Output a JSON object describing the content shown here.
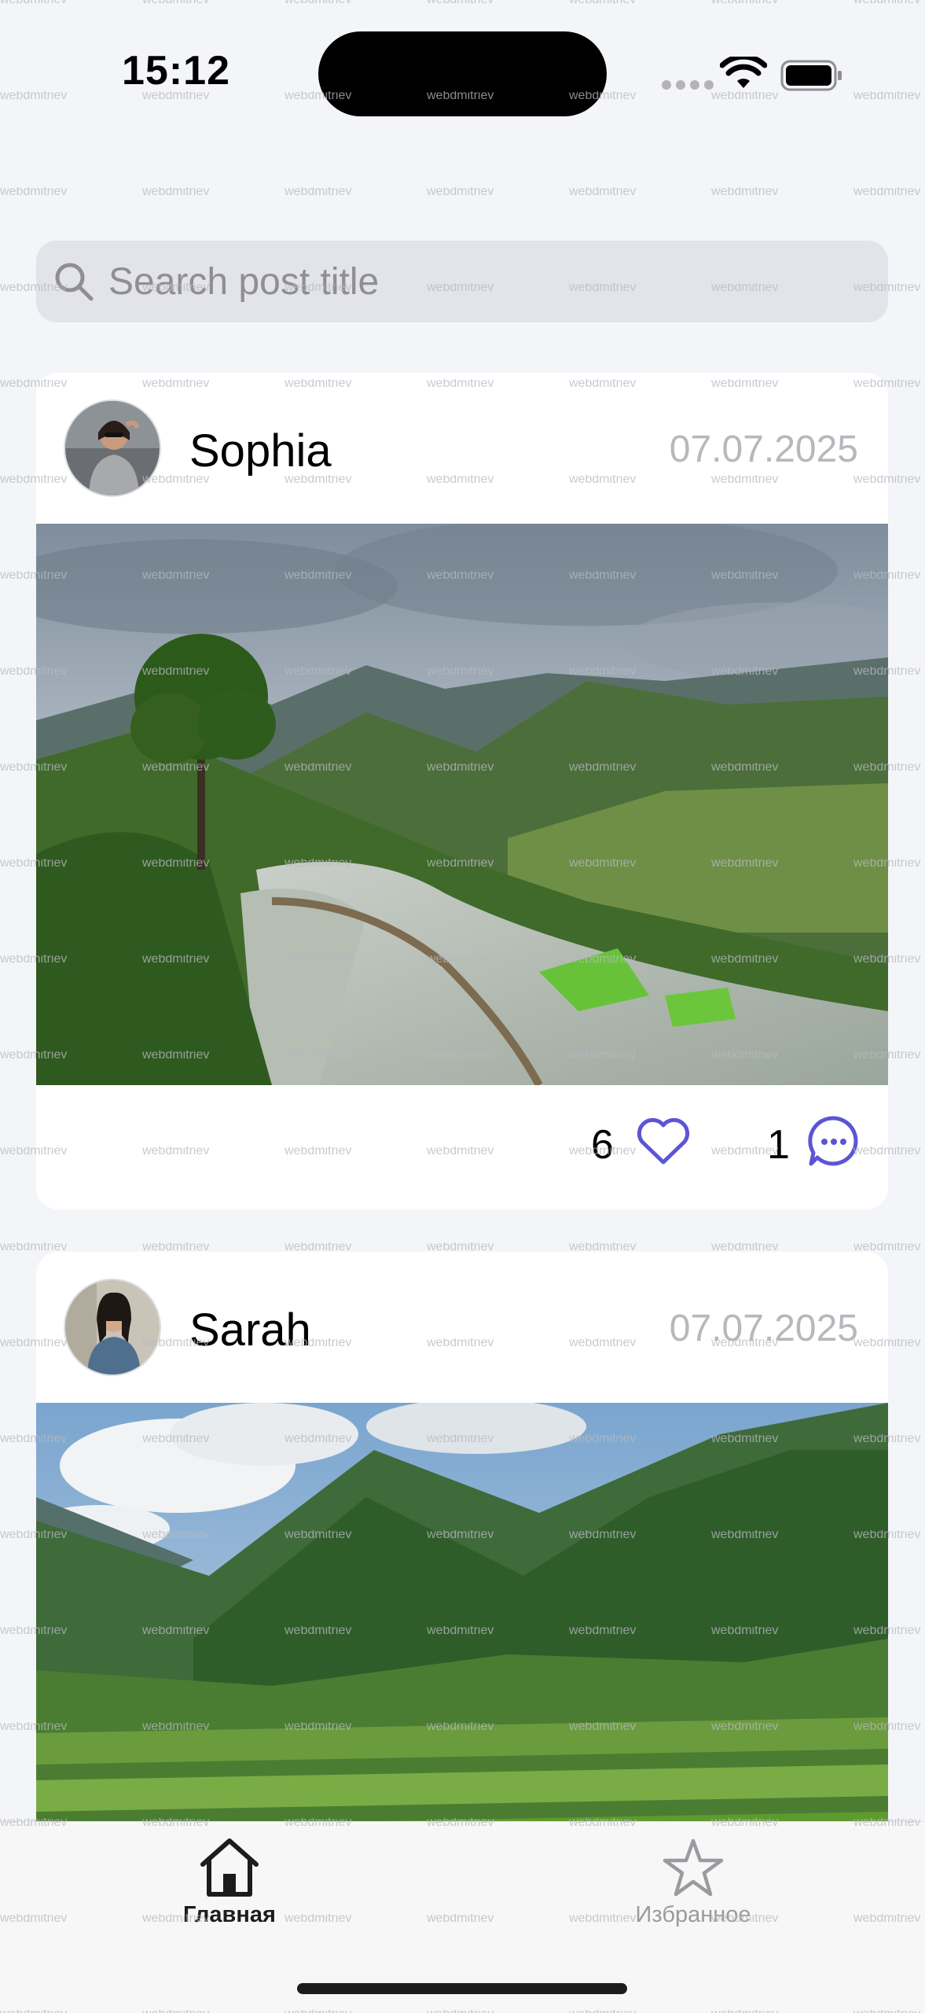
{
  "status_bar": {
    "time": "15:12"
  },
  "search": {
    "placeholder": "Search post title",
    "value": ""
  },
  "posts": [
    {
      "author": "Sophia",
      "date": "07.07.2025",
      "likes": "6",
      "comments": "1"
    },
    {
      "author": "Sarah",
      "date": "07.07.2025"
    }
  ],
  "tab_bar": {
    "tabs": [
      {
        "label": "Главная",
        "icon": "home-icon",
        "selected": true
      },
      {
        "label": "Избранное",
        "icon": "star-icon",
        "selected": false
      }
    ]
  },
  "watermark": "webdmitriev",
  "colors": {
    "accent": "#5b55d6",
    "background": "#f4f5f9",
    "muted_text": "#b7b7bc"
  }
}
